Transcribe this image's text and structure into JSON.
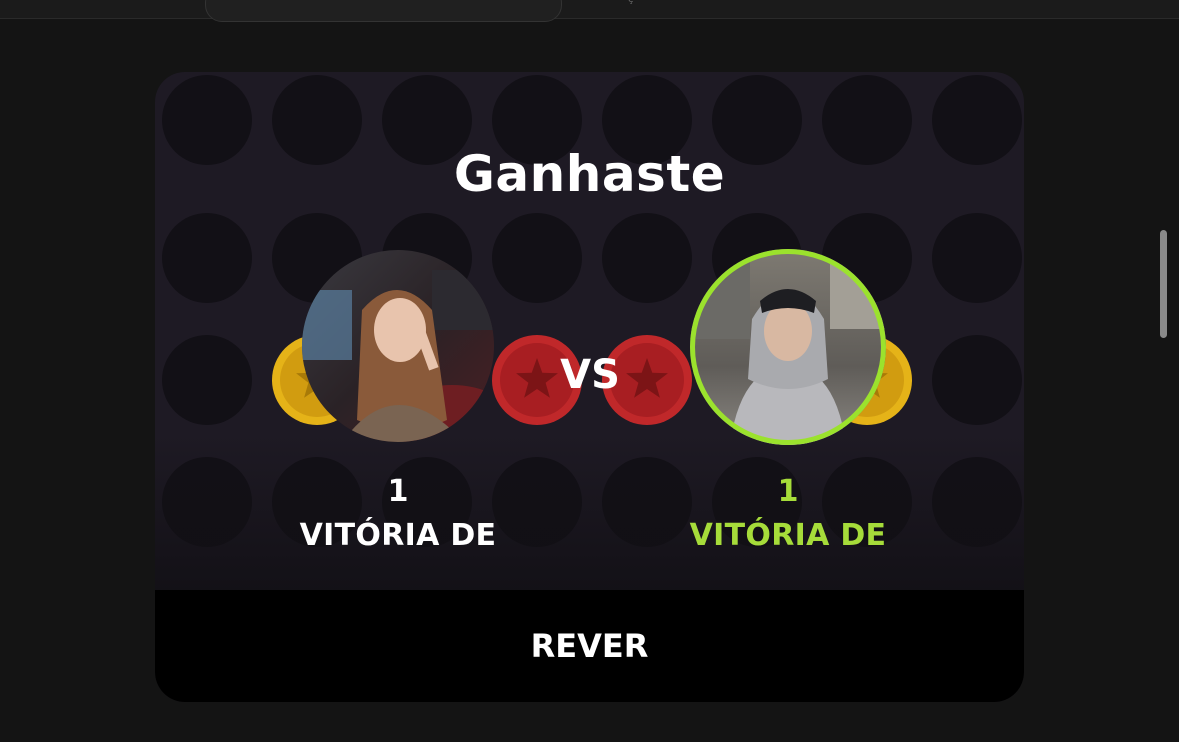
{
  "result": {
    "title": "Ganhaste",
    "vs_label": "VS"
  },
  "players": [
    {
      "avatar_desc": "avatar",
      "wins_count": "1",
      "wins_label": "VITÓRIA DE",
      "color": "#ffffff",
      "is_current_user": false
    },
    {
      "avatar_desc": "avatar",
      "wins_count": "1",
      "wins_label": "VITÓRIA DE",
      "color": "#a6dc3a",
      "is_current_user": true
    }
  ],
  "actions": {
    "replay_label": "REVER"
  },
  "colors": {
    "background": "#141414",
    "card": "#1e1a24",
    "empty_slot": "#121016",
    "red_disc": "#c0282a",
    "yellow_disc": "#e5b318",
    "accent_green": "#9be22d"
  },
  "board": {
    "discs": [
      {
        "row": 2,
        "col": 1,
        "color": "yellow"
      },
      {
        "row": 2,
        "col": 3,
        "color": "red"
      },
      {
        "row": 2,
        "col": 4,
        "color": "red"
      },
      {
        "row": 2,
        "col": 5,
        "color": "red"
      },
      {
        "row": 2,
        "col": 6,
        "color": "yellow"
      }
    ]
  }
}
